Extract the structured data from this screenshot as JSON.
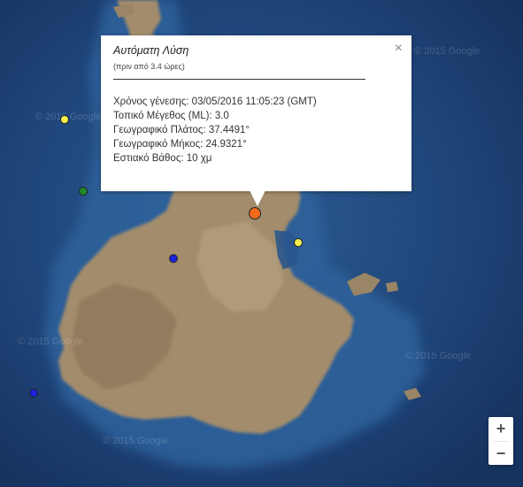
{
  "popup": {
    "title": "Αυτόματη Λύση",
    "subtitle": "(πριν από 3.4 ώρες)",
    "close_glyph": "×",
    "lines": [
      "Χρόνος γένεσης: 03/05/2016  11:05:23 (GMT)",
      "Τοπικό Μέγεθος (ML): 3.0",
      "Γεωγραφικό Πλάτος: 37.4491°",
      "Γεωγραφικό Μήκος: 24.9321°",
      "Εστιακό Βάθος: 10 χμ"
    ]
  },
  "markers": [
    {
      "name": "selected-event-marker",
      "color": "#f26a1b"
    },
    {
      "name": "event-marker-yellow-west",
      "color": "#f5ef4b"
    },
    {
      "name": "event-marker-yellow-east",
      "color": "#f5ef4b"
    },
    {
      "name": "event-marker-green",
      "color": "#1e8a2a"
    },
    {
      "name": "event-marker-blue-center",
      "color": "#1b22d9"
    },
    {
      "name": "event-marker-blue-southwest",
      "color": "#1b22d9"
    }
  ],
  "zoom": {
    "in_label": "+",
    "out_label": "−"
  },
  "watermarks": [
    "© 2015 Google",
    "© 2015 Google",
    "© 2015 Google",
    "© 2015 Google",
    "© 2015 Google"
  ],
  "colors": {
    "sea_deep": "#183a6c",
    "sea_shallow": "#2b5a90",
    "land": "#a69272"
  }
}
